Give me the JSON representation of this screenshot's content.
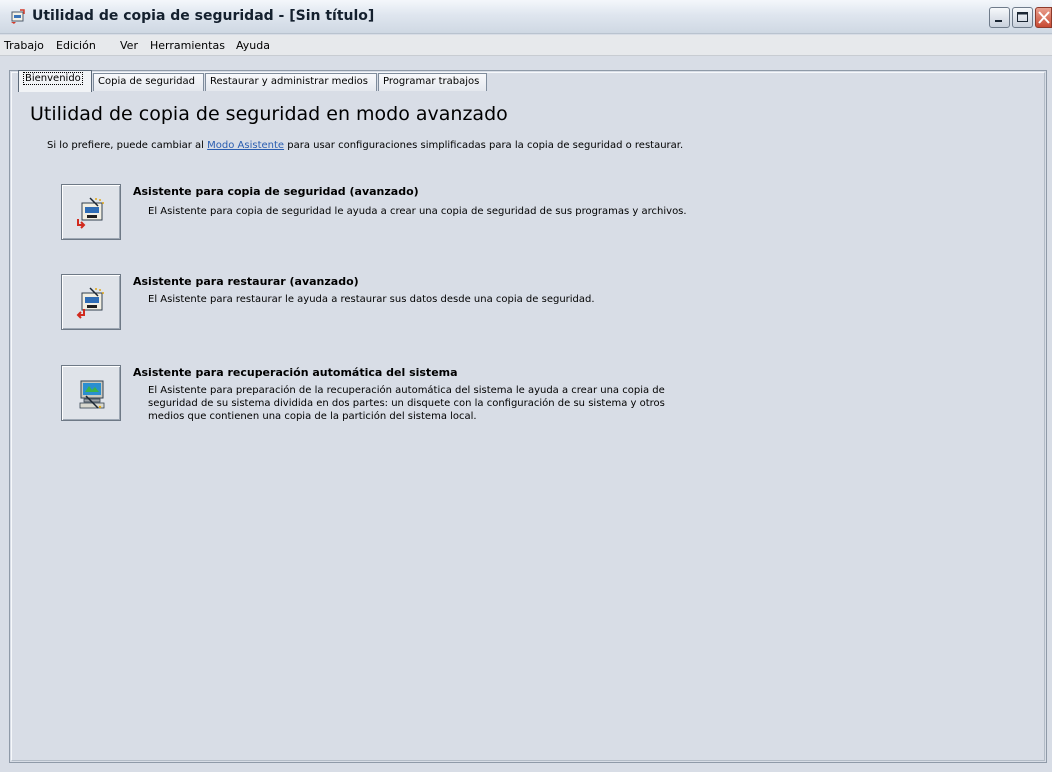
{
  "window": {
    "title": "Utilidad de copia de seguridad - [Sin título]",
    "app_icon": "backup-app-icon",
    "controls": [
      "minimize-icon",
      "maximize-icon",
      "close-icon"
    ]
  },
  "menu": {
    "items": [
      "Trabajo",
      "Edición",
      "Ver",
      "Herramientas",
      "Ayuda"
    ]
  },
  "tabs": [
    {
      "label": "Bienvenido",
      "active": true
    },
    {
      "label": "Copia de seguridad",
      "active": false
    },
    {
      "label": "Restaurar y administrar medios",
      "active": false
    },
    {
      "label": "Programar trabajos",
      "active": false
    }
  ],
  "welcome": {
    "heading": "Utilidad de copia de seguridad en modo avanzado",
    "intro_before": "Si lo prefiere, puede cambiar al ",
    "intro_link": "Modo Asistente",
    "intro_after": " para usar configuraciones simplificadas para la copia de seguridad o restaurar.",
    "wizards": [
      {
        "title": "Asistente para copia de seguridad (avanzado)",
        "description": "El Asistente para copia de seguridad le ayuda a crear una copia de seguridad de sus programas y archivos.",
        "icon": "backup-wizard-icon"
      },
      {
        "title": "Asistente para restaurar (avanzado)",
        "description": "El Asistente para restaurar le ayuda a restaurar sus datos desde una copia de seguridad.",
        "icon": "restore-wizard-icon"
      },
      {
        "title": "Asistente para recuperación automática del sistema",
        "description": "El Asistente para preparación de la recuperación automática del sistema le ayuda a crear una copia de seguridad de su sistema dividida en dos partes: un disquete con la configuración de su sistema y otros medios que contienen una copia de la partición del sistema local.",
        "icon": "asr-wizard-icon"
      }
    ]
  },
  "colors": {
    "background": "#d8dde6",
    "link": "#2a5db0",
    "close_button": "#c84a33"
  }
}
